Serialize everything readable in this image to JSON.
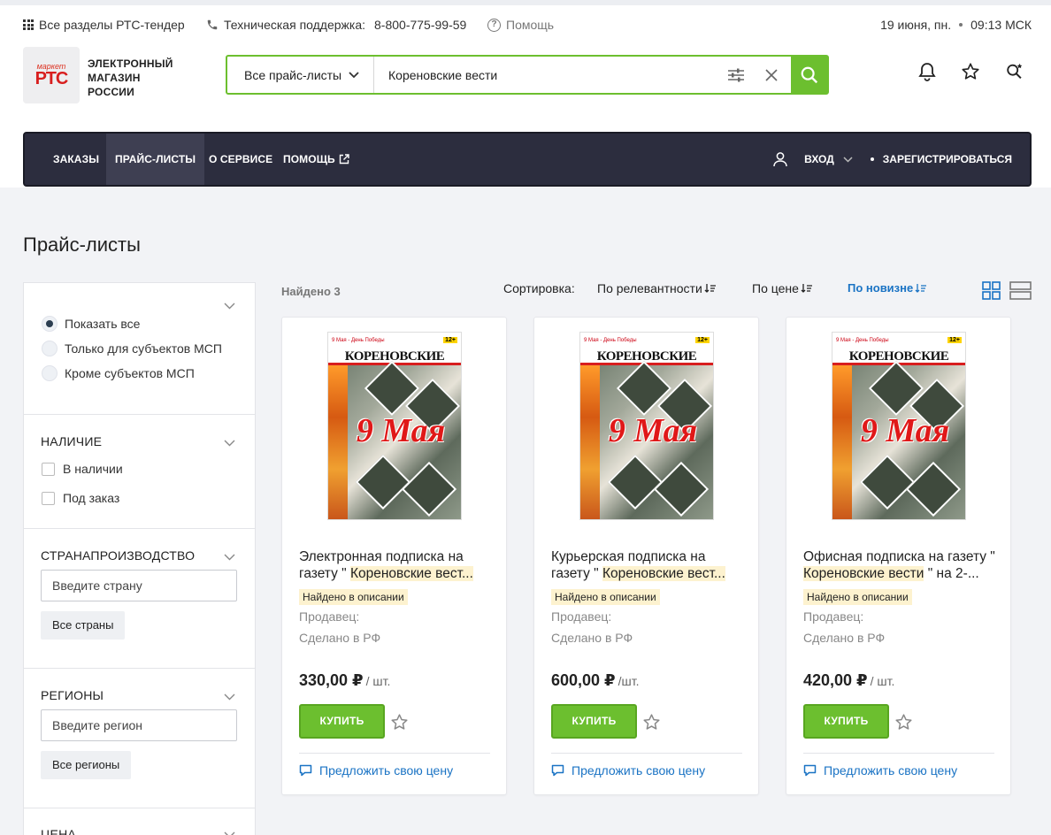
{
  "topbar": {
    "all_sections": "Все разделы РТС-тендер",
    "support_label": "Техническая поддержка:",
    "support_phone": "8-800-775-99-59",
    "help": "Помощь",
    "date": "19 июня, пн.",
    "time": "09:13 МСК"
  },
  "logo": {
    "small": "маркет",
    "big": "РТС",
    "line1": "ЭЛЕКТРОННЫЙ",
    "line2": "МАГАЗИН",
    "line3": "РОССИИ"
  },
  "search": {
    "scope": "Все прайс-листы",
    "query": "Кореновские вести"
  },
  "nav": {
    "items": [
      "ЗАКАЗЫ",
      "ПРАЙС-ЛИСТЫ",
      "О СЕРВИСЕ",
      "ПОМОЩЬ"
    ],
    "login": "ВХОД",
    "register": "ЗАРЕГИСТРИРОВАТЬСЯ"
  },
  "page": {
    "title": "Прайс-листы"
  },
  "sidebar": {
    "msp_options": [
      "Показать все",
      "Только для субъектов МСП",
      "Кроме субъектов МСП"
    ],
    "availability": {
      "title": "НАЛИЧИЕ",
      "options": [
        "В наличии",
        "Под заказ"
      ]
    },
    "country": {
      "title": "СТРАНАПРОИЗВОДСТВО",
      "placeholder": "Введите страну",
      "all": "Все страны"
    },
    "region": {
      "title": "РЕГИОНЫ",
      "placeholder": "Введите регион",
      "all": "Все регионы"
    },
    "price": {
      "title": "ЦЕНА"
    }
  },
  "results": {
    "found": "Найдено 3",
    "sort_label": "Сортировка:",
    "sort_options": [
      "По релевантности",
      "По цене",
      "По новизне"
    ]
  },
  "cover": {
    "header": "9 Мая - День Победы",
    "age": "12+",
    "title": "КОРЕНОВСКИЕ",
    "headline": "9 Мая"
  },
  "cards": [
    {
      "title_before": "Электронная подписка на газету \" ",
      "title_highlight": "Кореновские вест...",
      "title_after": "",
      "badge": "Найдено в описании",
      "seller": "Продавец:",
      "origin": "Сделано в РФ",
      "price": "330,00 ₽",
      "unit": "/ шт.",
      "buy": "КУПИТЬ",
      "offer": "Предложить свою цену"
    },
    {
      "title_before": "Курьерская подписка на газету \" ",
      "title_highlight": "Кореновские вест...",
      "title_after": "",
      "badge": "Найдено в описании",
      "seller": "Продавец:",
      "origin": "Сделано в РФ",
      "price": "600,00 ₽",
      "unit": "/шт.",
      "buy": "КУПИТЬ",
      "offer": "Предложить свою цену"
    },
    {
      "title_before": "Офисная подписка на газету \" ",
      "title_highlight": "Кореновские вести",
      "title_after": " \" на 2-...",
      "badge": "Найдено в описании",
      "seller": "Продавец:",
      "origin": "Сделано в РФ",
      "price": "420,00 ₽",
      "unit": "/ шт.",
      "buy": "КУПИТЬ",
      "offer": "Предложить свою цену"
    }
  ],
  "colors": {
    "accent_green": "#6cbf2f",
    "nav_bg": "#2c2d3e",
    "link_blue": "#1a73c4",
    "highlight": "#fdf2cf",
    "logo_red": "#d81e1e"
  }
}
